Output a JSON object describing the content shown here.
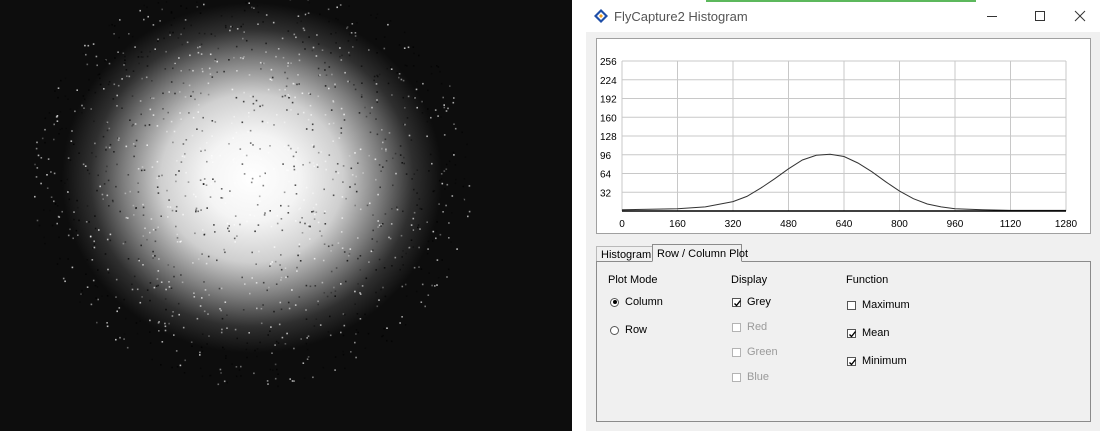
{
  "window": {
    "title": "FlyCapture2 Histogram",
    "icon": "flycapture-app-icon"
  },
  "controls": {
    "minimize": "minimize-icon",
    "maximize": "maximize-icon",
    "close": "close-icon"
  },
  "tabs": [
    {
      "label": "Histogram",
      "active": false
    },
    {
      "label": "Row / Column Plot",
      "active": true
    }
  ],
  "plot_mode": {
    "header": "Plot Mode",
    "options": [
      {
        "label": "Column",
        "selected": true
      },
      {
        "label": "Row",
        "selected": false
      }
    ]
  },
  "display": {
    "header": "Display",
    "options": [
      {
        "label": "Grey",
        "checked": true,
        "enabled": true
      },
      {
        "label": "Red",
        "checked": false,
        "enabled": false
      },
      {
        "label": "Green",
        "checked": false,
        "enabled": false
      },
      {
        "label": "Blue",
        "checked": false,
        "enabled": false
      }
    ]
  },
  "function": {
    "header": "Function",
    "options": [
      {
        "label": "Maximum",
        "checked": false
      },
      {
        "label": "Mean",
        "checked": true
      },
      {
        "label": "Minimum",
        "checked": true
      }
    ]
  },
  "chart_data": {
    "type": "line",
    "title": "",
    "xlabel": "",
    "ylabel": "",
    "xlim": [
      0,
      1280
    ],
    "ylim": [
      0,
      256
    ],
    "xticks": [
      0,
      160,
      320,
      480,
      640,
      800,
      960,
      1120,
      1280
    ],
    "yticks": [
      32,
      64,
      96,
      128,
      160,
      192,
      224,
      256
    ],
    "grid": true,
    "series": [
      {
        "x": [
          0,
          80,
          160,
          240,
          320,
          360,
          400,
          440,
          480,
          520,
          560,
          600,
          640,
          680,
          720,
          760,
          800,
          840,
          880,
          920,
          960,
          1040,
          1120,
          1200,
          1280
        ],
        "y": [
          2,
          3,
          4,
          7,
          16,
          25,
          39,
          55,
          72,
          87,
          95,
          97,
          93,
          82,
          67,
          50,
          34,
          21,
          12,
          7,
          4,
          2,
          1,
          1,
          1
        ]
      },
      {
        "x": [
          0,
          1280
        ],
        "y": [
          0,
          0
        ]
      }
    ],
    "colors": {
      "line": "#333333",
      "grid": "#c8c8c8",
      "axis": "#000000"
    }
  },
  "image": {
    "colors": {
      "background": "#000000",
      "spot": "#ffffff"
    }
  }
}
